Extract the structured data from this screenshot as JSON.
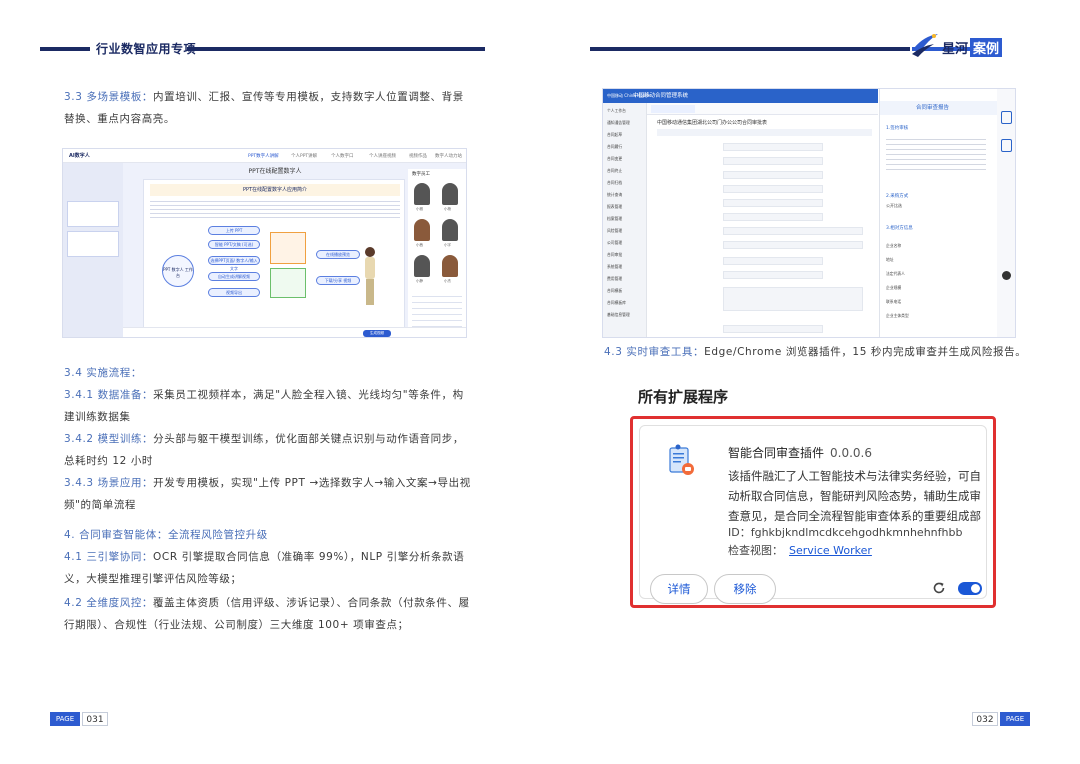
{
  "left_page": {
    "header_title": "行业数智应用专项",
    "para_3_3_label": "3.3 多场景模板：",
    "para_3_3_text": "内置培训、汇报、宣传等专用模板，支持数字人位置调整、背景替换、重点内容高亮。",
    "screenshot1": {
      "app_name": "AI数字人",
      "tabs": [
        "PPT数字人讲解",
        "个人PPT讲解",
        "个人数字口",
        "个人讲座视频",
        "视频作品",
        "数字人动力站"
      ],
      "canvas_title": "PPT在线配置数字人",
      "banner": "PPT在线配置数字人应用简介",
      "center_node": "PPT 数字人 工作台",
      "nodes": [
        "上传 PPT",
        "智能 PPT/文稿 (可选)",
        "选择PPT页面/ 数字人/输入文字",
        "自动生成讲解视频",
        "视频导出",
        "在线播放预览",
        "下载/分享 视频"
      ],
      "right_header": "数字员工",
      "person_labels": [
        "小雅",
        "小杨",
        "小茜",
        "小宇",
        "小静",
        "小杰"
      ],
      "button_label": "生成视频"
    },
    "para_3_4": "3.4 实施流程：",
    "para_3_4_1_label": "3.4.1 数据准备：",
    "para_3_4_1_text": "采集员工视频样本，满足\"人脸全程入镜、光线均匀\"等条件，构建训练数据集",
    "para_3_4_2_label": "3.4.2 模型训练：",
    "para_3_4_2_text": "分头部与躯干模型训练，优化面部关键点识别与动作语音同步，总耗时约 12 小时",
    "para_3_4_3_label": "3.4.3 场景应用：",
    "para_3_4_3_text": "开发专用模板，实现\"上传 PPT →选择数字人→输入文案→导出视频\"的简单流程",
    "para_4": "4. 合同审查智能体：全流程风险管控升级",
    "para_4_1_label": "4.1 三引擎协同：",
    "para_4_1_text": "OCR 引擎提取合同信息（准确率 99%），NLP 引擎分析条款语义，大模型推理引擎评估风险等级；",
    "para_4_2_label": "4.2 全维度风控：",
    "para_4_2_text": "覆盖主体资质（信用评级、涉诉记录）、合同条款（付款条件、履行期限）、合规性（行业法规、公司制度）三大维度 100+ 项审查点；",
    "footer_label": "PAGE",
    "footer_num": "031"
  },
  "right_page": {
    "logo_text": "星河",
    "logo_text_highlight": "案例",
    "screenshot2": {
      "system_title": "中国移动合同管理系统",
      "brand": "中国移动 China Mobile",
      "page_heading": "中国移动通信集团湖北公司门办公公司合同审批表",
      "panel_title": "合同审查报告",
      "sections": [
        "1.签约审核",
        "2.采购方式",
        "3.相对方信息"
      ],
      "section2_value": "公开比选",
      "nav_items": [
        "个人工作台",
        "通知通告管理",
        "合同起草",
        "合同履行",
        "合同变更",
        "合同终止",
        "合同归档",
        "统计查询",
        "报表管理",
        "档案管理",
        "风险管理",
        "公司管理",
        "合同审批",
        "系统管理",
        "费用管理",
        "合同模板",
        "合同模板库",
        "基础信息管理"
      ],
      "party_labels": [
        "企业名称",
        "地址",
        "法定代表人",
        "企业规模",
        "联系电话",
        "企业主体类型"
      ]
    },
    "caption_label": "4.3 实时审查工具：",
    "caption_text": "Edge/Chrome 浏览器插件，15 秒内完成审查并生成风险报告。",
    "extensions_title": "所有扩展程序",
    "extension": {
      "name": "智能合同审查插件",
      "version": "0.0.0.6",
      "description": "该插件融汇了人工智能技术与法律实务经验，可自动析取合同信息，智能研判风险态势，辅助生成审查意见，是合同全流程智能审查体系的重要组成部",
      "id_label": "ID：",
      "id_value": "fghkbjkndlmcdkcehgodhkmnhehnfhbb",
      "inspect_label": "检查视图：",
      "inspect_link": "Service Worker",
      "details_button": "详情",
      "remove_button": "移除",
      "enabled": true
    },
    "footer_label": "PAGE",
    "footer_num": "032"
  },
  "colors": {
    "navy": "#1b2a63",
    "accent_blue": "#2d5bd0",
    "subheading": "#4a6fb8",
    "highlight_red": "#e03030",
    "link_blue": "#1a57d6"
  }
}
